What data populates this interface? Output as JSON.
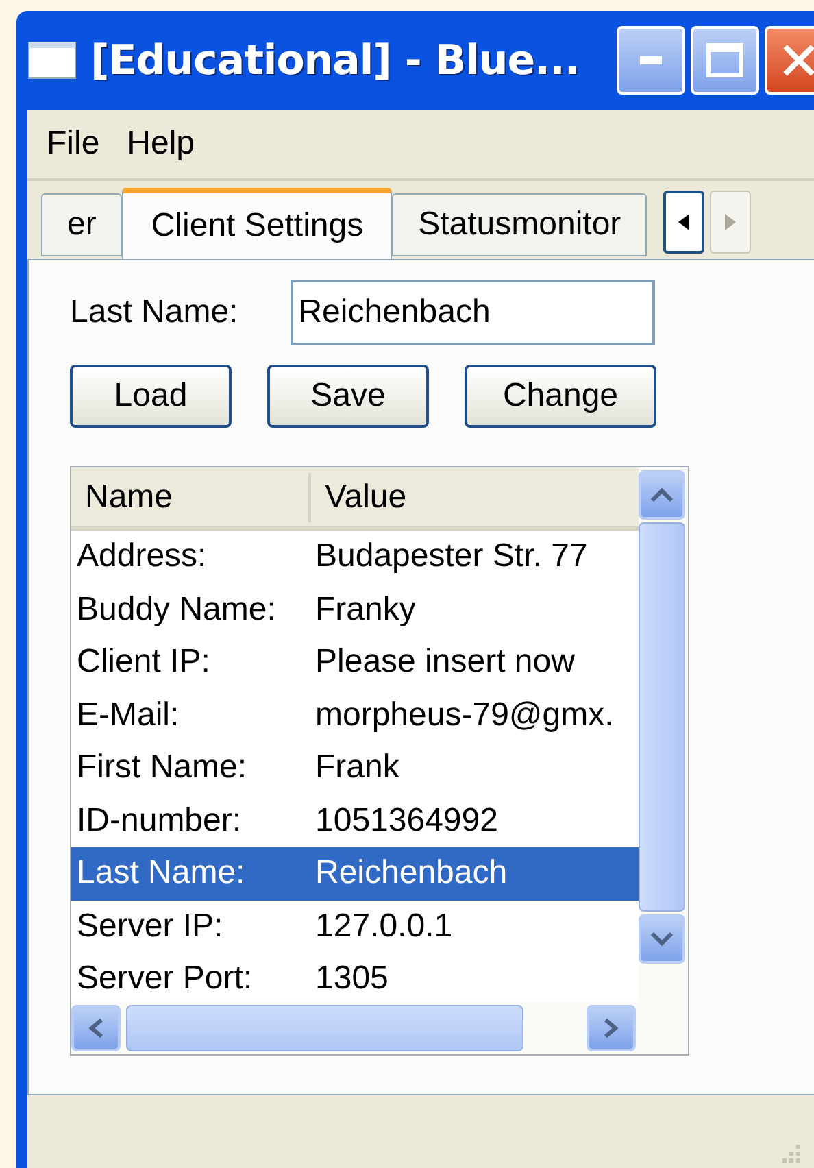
{
  "window": {
    "title": "[Educational] - Blue..."
  },
  "menu": [
    "File",
    "Help"
  ],
  "tabs": [
    {
      "label": "er",
      "selected": false
    },
    {
      "label": "Client Settings",
      "selected": true
    },
    {
      "label": "Statusmonitor",
      "selected": false
    }
  ],
  "form": {
    "label": "Last Name:",
    "value": "Reichenbach"
  },
  "buttons": [
    "Load",
    "Save",
    "Change"
  ],
  "list": {
    "columns": [
      "Name",
      "Value"
    ],
    "rows": [
      {
        "name": "Address:",
        "value": "Budapester Str. 77",
        "selected": false
      },
      {
        "name": "Buddy Name:",
        "value": "Franky",
        "selected": false
      },
      {
        "name": "Client IP:",
        "value": "Please insert now",
        "selected": false
      },
      {
        "name": "E-Mail:",
        "value": "morpheus-79@gmx.",
        "selected": false
      },
      {
        "name": "First Name:",
        "value": "Frank",
        "selected": false
      },
      {
        "name": "ID-number:",
        "value": "1051364992",
        "selected": false
      },
      {
        "name": "Last Name:",
        "value": "Reichenbach",
        "selected": true
      },
      {
        "name": "Server IP:",
        "value": "127.0.0.1",
        "selected": false
      },
      {
        "name": "Server Port:",
        "value": "1305",
        "selected": false
      }
    ]
  }
}
